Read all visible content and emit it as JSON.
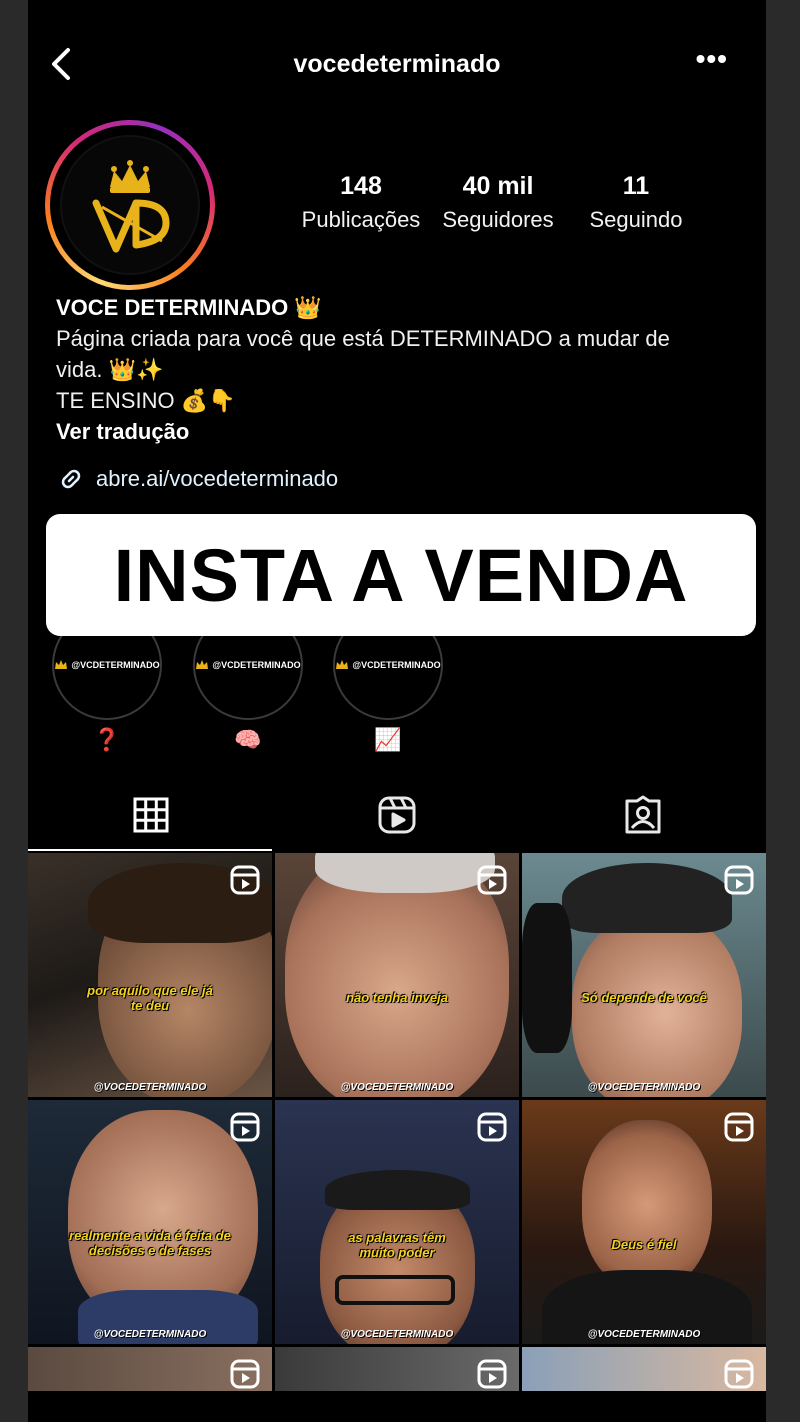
{
  "header": {
    "username": "vocedeterminado"
  },
  "profile": {
    "logo_text": "VD",
    "stats": [
      {
        "value": "148",
        "label": "Publicações"
      },
      {
        "value": "40 mil",
        "label": "Seguidores"
      },
      {
        "value": "11",
        "label": "Seguindo"
      }
    ],
    "bio": {
      "name": "VOCE DETERMINADO 👑",
      "line1": "Página criada para você que está DETERMINADO a mudar de",
      "line2": "vida. 👑✨",
      "line3": "TE ENSINO 💰👇",
      "translate": "Ver tradução"
    },
    "link": "abre.ai/vocedeterminado"
  },
  "banner": {
    "text": "INSTA A VENDA"
  },
  "highlights": [
    {
      "tag": "@VCDETERMINADO",
      "emoji": "❓"
    },
    {
      "tag": "@VCDETERMINADO",
      "emoji": "🧠"
    },
    {
      "tag": "@VCDETERMINADO",
      "emoji": "📈"
    }
  ],
  "posts": [
    {
      "caption": "por aquilo que ele já te deu",
      "handle": "@VOCEDETERMINADO"
    },
    {
      "caption": "não tenha inveja",
      "handle": "@VOCEDETERMINADO"
    },
    {
      "caption": "Só depende de você",
      "handle": "@VOCEDETERMINADO"
    },
    {
      "caption": "realmente a vida é feita de decisões e de fases",
      "handle": "@VOCEDETERMINADO"
    },
    {
      "caption": "as palavras têm muito poder",
      "handle": "@VOCEDETERMINADO"
    },
    {
      "caption": "Deus é fiel",
      "handle": "@VOCEDETERMINADO"
    }
  ],
  "colors": {
    "caption": "#f5d220",
    "gold": "#e8b21a",
    "background": "#000000"
  },
  "icons": {
    "back": "chevron-left-icon",
    "more": "more-horizontal-icon",
    "link": "link-icon",
    "grid_tab": "grid-icon",
    "reels_tab": "reels-icon",
    "tagged_tab": "tagged-user-icon",
    "reel": "reel-icon"
  }
}
